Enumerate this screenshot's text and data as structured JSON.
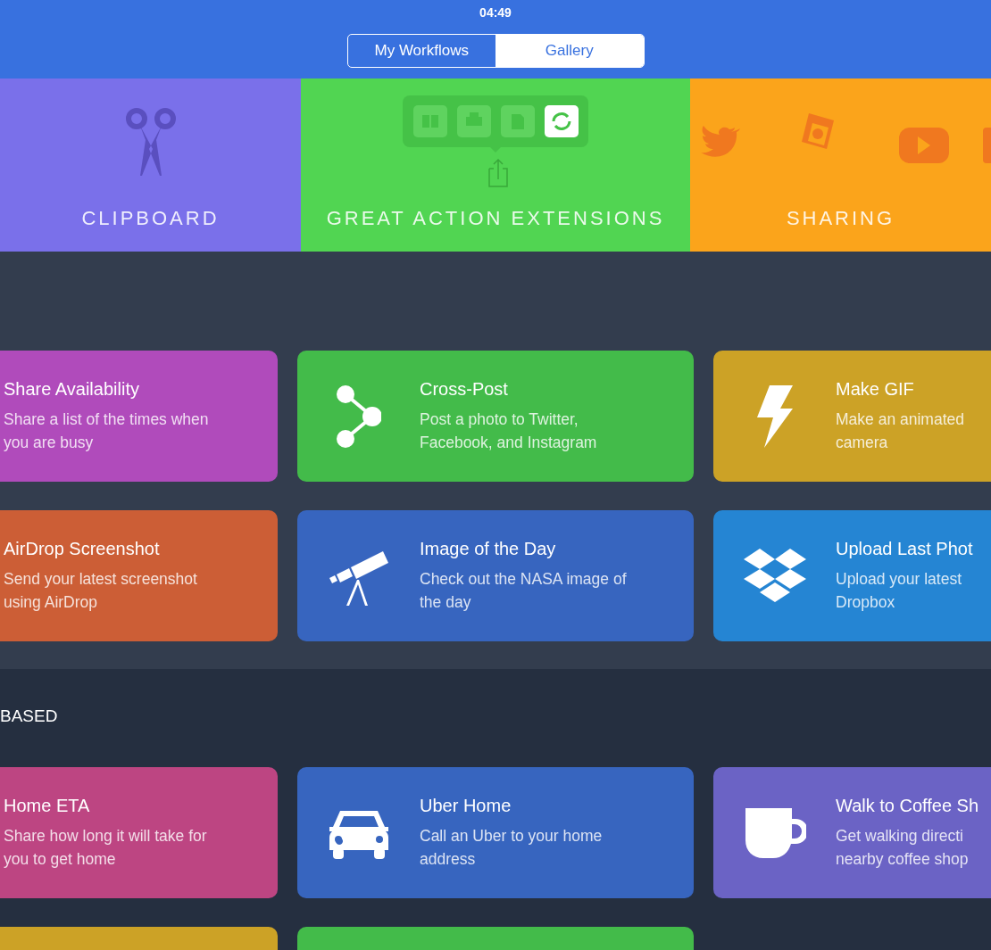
{
  "status_bar": {
    "time": "04:49"
  },
  "segments": [
    {
      "label": "My Workflows",
      "selected": false
    },
    {
      "label": "Gallery",
      "selected": true
    }
  ],
  "banners": [
    {
      "label": "CLIPBOARD",
      "color": "#7a70ea",
      "kind": "scissors"
    },
    {
      "label": "GREAT ACTION EXTENSIONS",
      "color": "#51d552",
      "kind": "actions"
    },
    {
      "label": "SHARING",
      "color": "#fba41b",
      "kind": "social"
    }
  ],
  "sections": [
    {
      "cards": [
        {
          "title": "Share Availability",
          "lines": [
            "Share a list of the times when",
            "you are busy"
          ],
          "color": "#b04bbb"
        },
        {
          "title": "Cross-Post",
          "lines": [
            "Post a photo to Twitter,",
            "Facebook, and Instagram"
          ],
          "color": "#43bb4a",
          "kind": "share"
        },
        {
          "title": "Make GIF",
          "lines": [
            "Make an animated",
            "camera"
          ],
          "color": "#cca226",
          "kind": "bolt"
        },
        {
          "title": "AirDrop Screenshot",
          "lines": [
            "Send your latest screenshot",
            "using AirDrop"
          ],
          "color": "#cc5e36"
        },
        {
          "title": "Image of the Day",
          "lines": [
            "Check out the NASA image of",
            "the day"
          ],
          "color": "#3765bf",
          "kind": "telescope"
        },
        {
          "title": "Upload Last Phot",
          "lines": [
            "Upload your latest",
            "Dropbox"
          ],
          "color": "#2585d3",
          "kind": "boxes"
        }
      ]
    },
    {
      "title": "BASED",
      "cards": [
        {
          "title": "Home ETA",
          "lines": [
            "Share how long it will take for",
            "you to get home"
          ],
          "color": "#bd4582"
        },
        {
          "title": "Uber Home",
          "lines": [
            "Call an Uber to your home",
            "address"
          ],
          "color": "#3765bf",
          "kind": "car"
        },
        {
          "title": "Walk to Coffee Sh",
          "lines": [
            "Get walking directi",
            "nearby coffee shop"
          ],
          "color": "#6b63c5",
          "kind": "mug"
        },
        {
          "color": "#cca226"
        },
        {
          "color": "#43bb4a"
        }
      ]
    }
  ]
}
